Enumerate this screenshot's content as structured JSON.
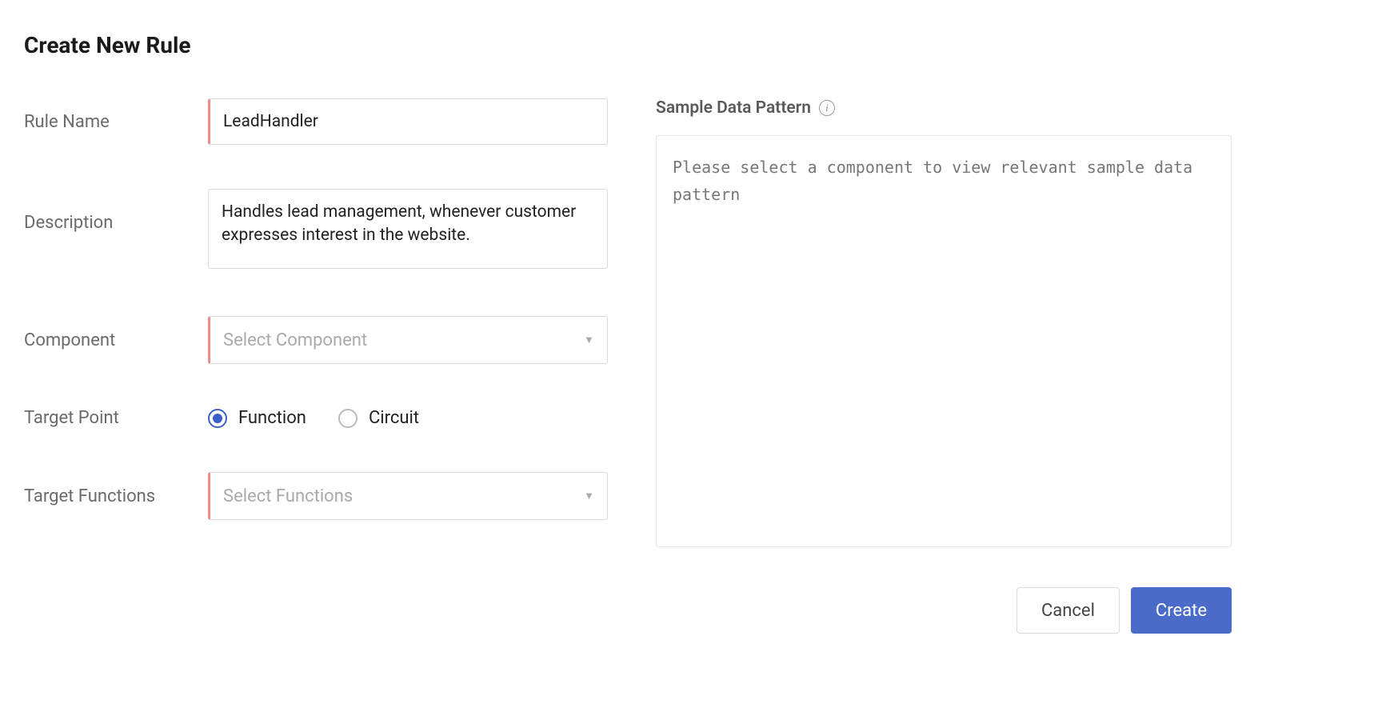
{
  "title": "Create New Rule",
  "form": {
    "ruleName": {
      "label": "Rule Name",
      "value": "LeadHandler"
    },
    "description": {
      "label": "Description",
      "value": "Handles lead management, whenever customer expresses interest in the website."
    },
    "component": {
      "label": "Component",
      "placeholder": "Select Component"
    },
    "targetPoint": {
      "label": "Target Point",
      "options": {
        "function": "Function",
        "circuit": "Circuit"
      },
      "selected": "function"
    },
    "targetFunctions": {
      "label": "Target Functions",
      "placeholder": "Select Functions"
    }
  },
  "sample": {
    "title": "Sample Data Pattern",
    "placeholder": "Please select a component to view relevant sample data pattern"
  },
  "buttons": {
    "cancel": "Cancel",
    "create": "Create"
  }
}
